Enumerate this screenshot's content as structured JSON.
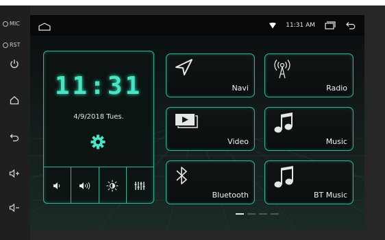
{
  "hardware": {
    "mic_label": "MIC",
    "rst_label": "RST"
  },
  "status_bar": {
    "time": "11:31 AM"
  },
  "clock_widget": {
    "time_digits": "11:31",
    "date": "4/9/2018  Tues."
  },
  "apps": [
    {
      "label": "Navi",
      "icon": "navigation-arrow-icon"
    },
    {
      "label": "Radio",
      "icon": "radio-antenna-icon"
    },
    {
      "label": "Video",
      "icon": "video-player-icon"
    },
    {
      "label": "Music",
      "icon": "music-note-icon"
    },
    {
      "label": "Bluetooth",
      "icon": "bluetooth-icon"
    },
    {
      "label": "BT Music",
      "icon": "bt-music-icon"
    }
  ],
  "page_indicator": {
    "pages": 4,
    "active_page": 1
  },
  "colors": {
    "accent": "#2fb99a",
    "digit_glow": "#4be3c4",
    "background": "#0a0d0f"
  }
}
